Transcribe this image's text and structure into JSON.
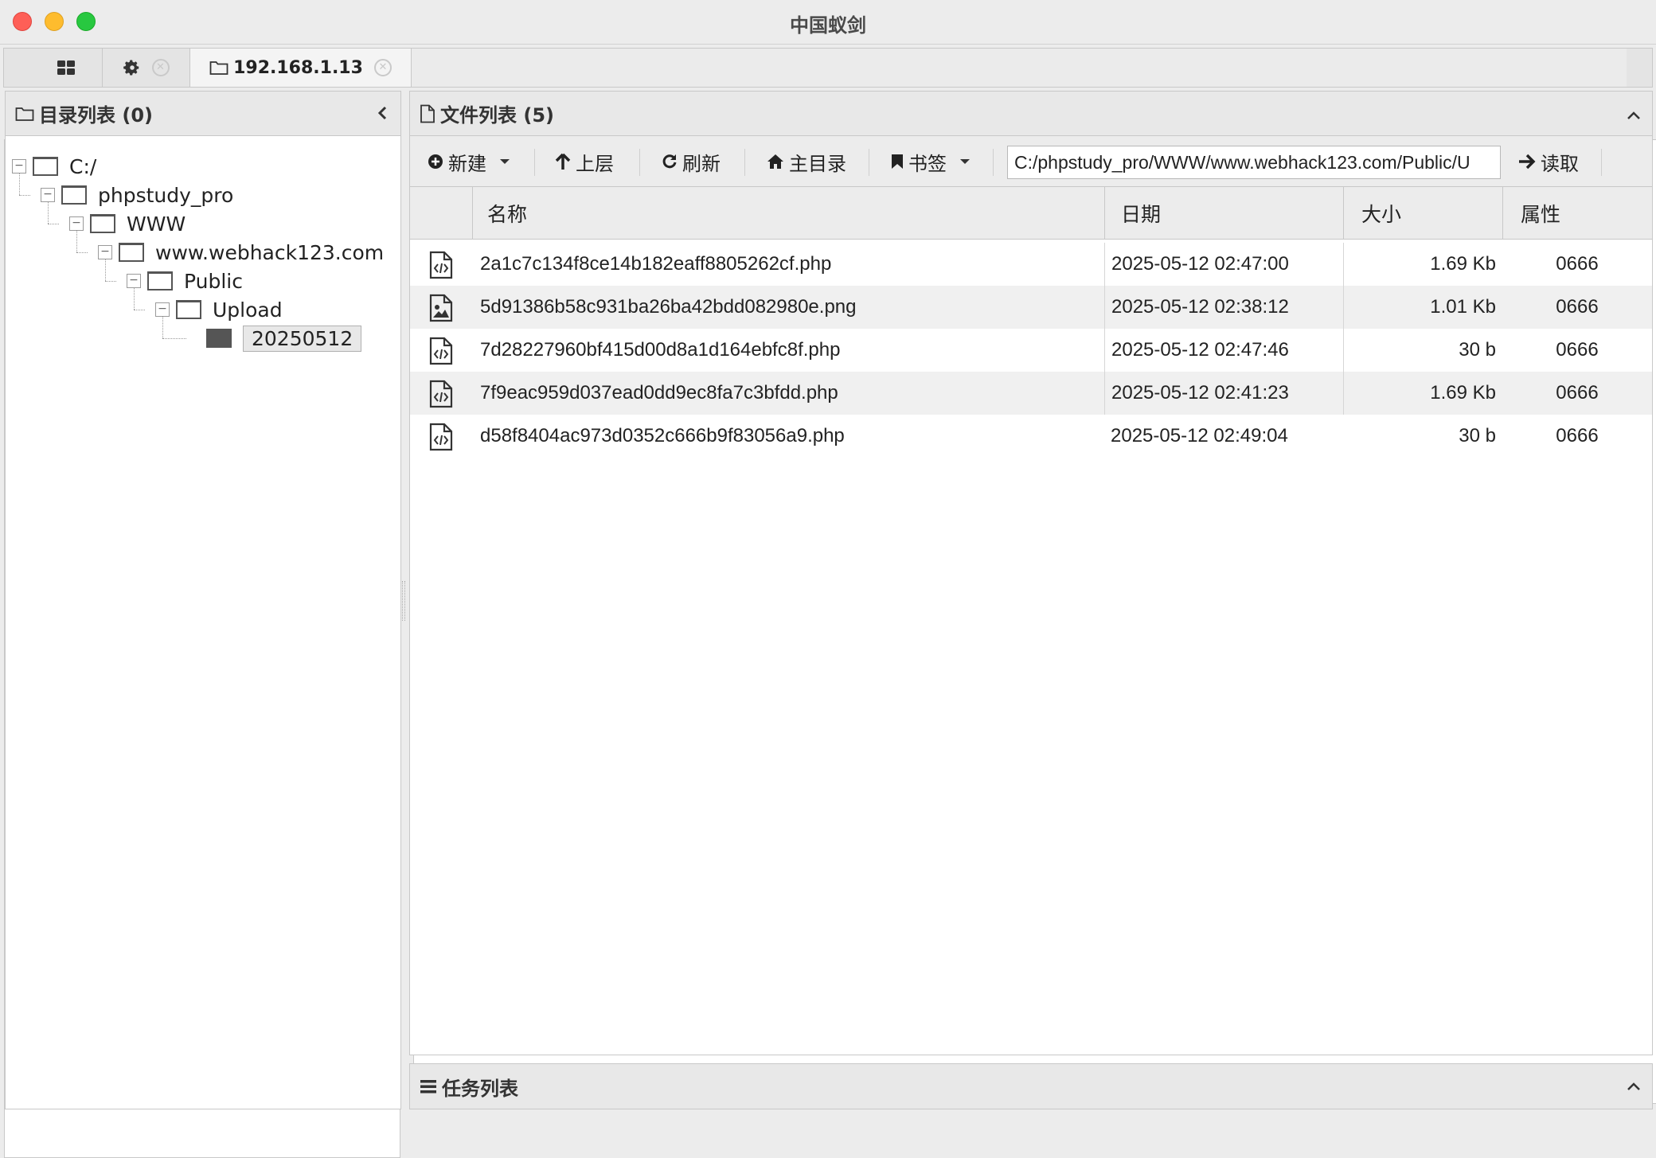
{
  "window": {
    "title": "中国蚁剑"
  },
  "tabs": {
    "host_label": "192.168.1.13"
  },
  "left_panel": {
    "title": "目录列表 (0)",
    "tree": [
      {
        "label": "C:/",
        "level": 0
      },
      {
        "label": "phpstudy_pro",
        "level": 1
      },
      {
        "label": "WWW",
        "level": 2
      },
      {
        "label": "www.webhack123.com",
        "level": 3
      },
      {
        "label": "Public",
        "level": 4
      },
      {
        "label": "Upload",
        "level": 5
      },
      {
        "label": "20250512",
        "level": 6,
        "selected": true
      }
    ]
  },
  "right_panel": {
    "title": "文件列表 (5)",
    "toolbar": {
      "new_label": "新建",
      "up_label": "上层",
      "refresh_label": "刷新",
      "home_label": "主目录",
      "bookmark_label": "书签",
      "path_value": "C:/phpstudy_pro/WWW/www.webhack123.com/Public/U",
      "read_label": "读取"
    },
    "columns": {
      "name": "名称",
      "date": "日期",
      "size": "大小",
      "attr": "属性"
    },
    "files": [
      {
        "name": "2a1c7c134f8ce14b182eaff8805262cf.php",
        "date": "2025-05-12 02:47:00",
        "size": "1.69 Kb",
        "attr": "0666",
        "icon": "code-file-icon"
      },
      {
        "name": "5d91386b58c931ba26ba42bdd082980e.png",
        "date": "2025-05-12 02:38:12",
        "size": "1.01 Kb",
        "attr": "0666",
        "icon": "image-file-icon"
      },
      {
        "name": "7d28227960bf415d00d8a1d164ebfc8f.php",
        "date": "2025-05-12 02:47:46",
        "size": "30 b",
        "attr": "0666",
        "icon": "code-file-icon"
      },
      {
        "name": "7f9eac959d037ead0dd9ec8fa7c3bfdd.php",
        "date": "2025-05-12 02:41:23",
        "size": "1.69 Kb",
        "attr": "0666",
        "icon": "code-file-icon"
      },
      {
        "name": "d58f8404ac973d0352c666b9f83056a9.php",
        "date": "2025-05-12 02:49:04",
        "size": "30 b",
        "attr": "0666",
        "icon": "code-file-icon"
      }
    ]
  },
  "task_panel": {
    "title": "任务列表"
  }
}
